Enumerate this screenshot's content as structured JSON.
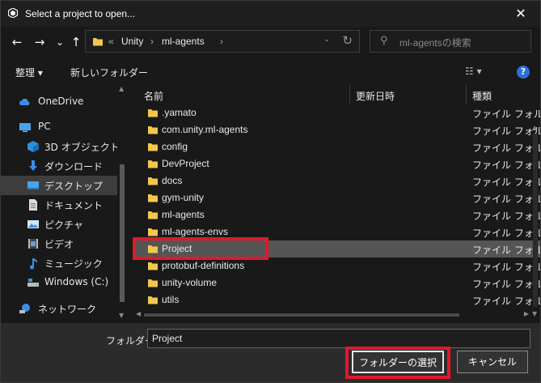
{
  "window": {
    "title": "Select a project to open..."
  },
  "nav": {
    "back": "←",
    "forward": "→",
    "recent": "⌄",
    "up": "↑",
    "address": [
      "«",
      "Unity",
      "›",
      "ml-agents",
      "›"
    ],
    "search_placeholder": "ml-agentsの検索"
  },
  "toolbar": {
    "organize": "整理 ▾",
    "new_folder": "新しいフォルダー",
    "view": "☷ ▾",
    "help": "?"
  },
  "sidebar": {
    "items": [
      {
        "label": "OneDrive",
        "icon": "cloud-icon"
      },
      {
        "label": "PC",
        "icon": "computer-icon"
      },
      {
        "label": "3D オブジェクト",
        "icon": "cube-icon"
      },
      {
        "label": "ダウンロード",
        "icon": "download-icon"
      },
      {
        "label": "デスクトップ",
        "icon": "desktop-icon",
        "selected": true
      },
      {
        "label": "ドキュメント",
        "icon": "document-icon"
      },
      {
        "label": "ピクチャ",
        "icon": "picture-icon"
      },
      {
        "label": "ビデオ",
        "icon": "video-icon"
      },
      {
        "label": "ミュージック",
        "icon": "music-icon"
      },
      {
        "label": "Windows (C:)",
        "icon": "drive-icon"
      },
      {
        "label": "ネットワーク",
        "icon": "network-icon"
      }
    ]
  },
  "columns": {
    "name": "名前",
    "date": "更新日時",
    "type": "種類"
  },
  "files": [
    {
      "name": ".yamato",
      "type": "ファイル フォルダー"
    },
    {
      "name": "com.unity.ml-agents",
      "type": "ファイル フォルダー"
    },
    {
      "name": "config",
      "type": "ファイル フォルダー"
    },
    {
      "name": "DevProject",
      "type": "ファイル フォルダー"
    },
    {
      "name": "docs",
      "type": "ファイル フォルダー"
    },
    {
      "name": "gym-unity",
      "type": "ファイル フォルダー"
    },
    {
      "name": "ml-agents",
      "type": "ファイル フォルダー"
    },
    {
      "name": "ml-agents-envs",
      "type": "ファイル フォルダー"
    },
    {
      "name": "Project",
      "type": "ファイル フォルダー",
      "selected": true
    },
    {
      "name": "protobuf-definitions",
      "type": "ファイル フォルダー"
    },
    {
      "name": "unity-volume",
      "type": "ファイル フォルダー"
    },
    {
      "name": "utils",
      "type": "ファイル フォルダー"
    }
  ],
  "footer": {
    "folder_label": "フォルダー:",
    "folder_value": "Project",
    "select_button": "フォルダーの選択",
    "cancel_button": "キャンセル"
  },
  "colors": {
    "highlight": "#e0192b",
    "folder": "#f3c64c",
    "accent": "#2a6fdc"
  }
}
